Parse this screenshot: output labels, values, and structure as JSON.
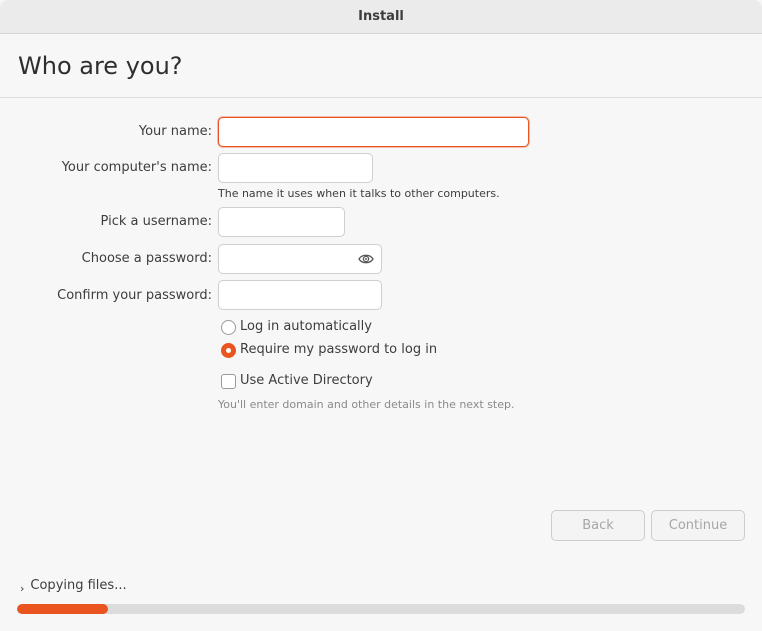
{
  "window": {
    "title": "Install"
  },
  "page": {
    "heading": "Who are you?"
  },
  "form": {
    "name_label": "Your name:",
    "name_value": "",
    "computer_label": "Your computer's name:",
    "computer_value": "",
    "computer_hint": "The name it uses when it talks to other computers.",
    "username_label": "Pick a username:",
    "username_value": "",
    "password_label": "Choose a password:",
    "password_value": "",
    "confirm_label": "Confirm your password:",
    "confirm_value": "",
    "login_auto_label": "Log in automatically",
    "login_auto_selected": false,
    "require_password_label": "Require my password to log in",
    "require_password_selected": true,
    "active_directory_label": "Use Active Directory",
    "active_directory_checked": false,
    "active_directory_hint": "You'll enter domain and other details in the next step."
  },
  "buttons": {
    "back_label": "Back",
    "continue_label": "Continue"
  },
  "progress": {
    "label": "Copying files...",
    "fraction": 0.125
  },
  "icons": {
    "reveal_password": "eye-icon",
    "expander": "chevron-right-icon"
  },
  "colors": {
    "accent": "#e95420",
    "track": "#dcdcdc",
    "disabled_text": "#a6a6a6"
  }
}
